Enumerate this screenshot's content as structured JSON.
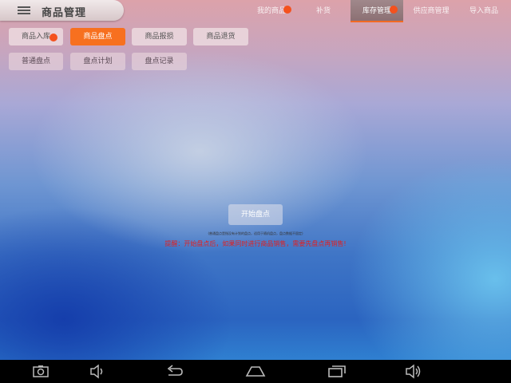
{
  "header": {
    "title": "商品管理"
  },
  "nav_tabs": [
    {
      "label": "我的商品",
      "active": false,
      "badge": true
    },
    {
      "label": "补货",
      "active": false,
      "badge": false
    },
    {
      "label": "库存管理",
      "active": true,
      "badge": true
    },
    {
      "label": "供应商管理",
      "active": false,
      "badge": false
    },
    {
      "label": "导入商品",
      "active": false,
      "badge": false
    }
  ],
  "actions_row1": [
    {
      "label": "商品入库",
      "style": "default",
      "badge": true
    },
    {
      "label": "商品盘点",
      "style": "selected"
    },
    {
      "label": "商品报损",
      "style": "default"
    },
    {
      "label": "商品退货",
      "style": "default"
    }
  ],
  "actions_row2": [
    {
      "label": "普通盘点"
    },
    {
      "label": "盘点计划"
    },
    {
      "label": "盘点记录"
    }
  ],
  "main": {
    "start_button": "开始盘点",
    "note": "(普通盘点是指没有计划的盘点，适用于随机盘点，盘点数据不固定)",
    "warning": "提醒：开始盘点后，如果同时进行商品销售，需要先盘点再销售!"
  },
  "system_nav": {
    "icons": [
      "camera-icon",
      "volume-down-icon",
      "back-icon",
      "home-icon",
      "recents-icon",
      "volume-up-icon"
    ]
  },
  "colors": {
    "accent": "#f7701f",
    "badge": "#f4511e",
    "warning": "#e02020"
  }
}
